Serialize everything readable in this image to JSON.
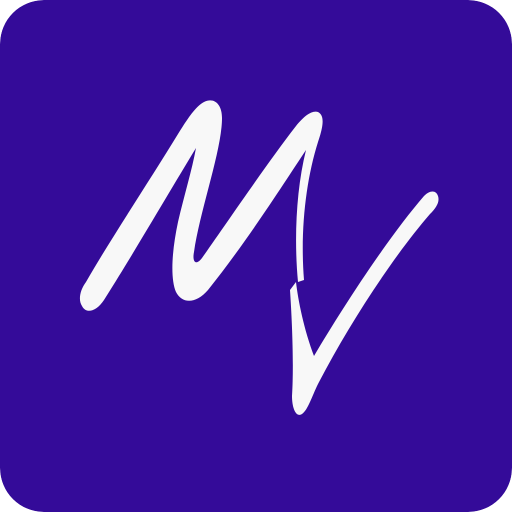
{
  "icon": {
    "name": "app-logo-icon",
    "description_glyph": "MV",
    "background_color": "#340b99",
    "glyph_color": "#f8f8f8"
  }
}
